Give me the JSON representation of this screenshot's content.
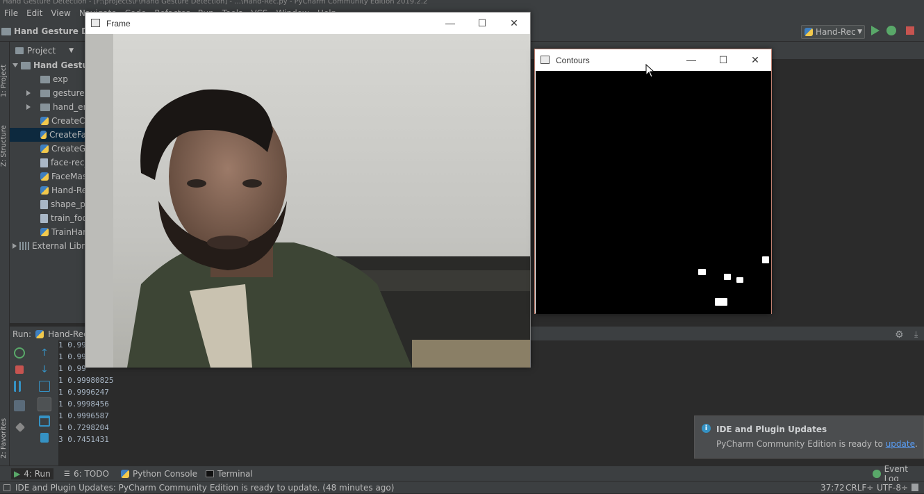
{
  "titlebar": {
    "text": "Hand Gesture Detection - [F:\\projects\\F\\Hand Gesture Detection] - ...\\Hand-Rec.py - PyCharm Community Edition 2019.2.2"
  },
  "menu": [
    "File",
    "Edit",
    "View",
    "Navigate",
    "Code",
    "Refactor",
    "Run",
    "Tools",
    "VCS",
    "Window",
    "Help"
  ],
  "navbar": {
    "project_crumb": "Hand Gesture Det",
    "run_config": "Hand-Rec"
  },
  "project_pane": {
    "header": "Project",
    "root": "Hand Gesture",
    "items": [
      {
        "label": "exp",
        "kind": "folder",
        "expandable": false
      },
      {
        "label": "gestures",
        "kind": "folder",
        "expandable": true
      },
      {
        "label": "hand_em",
        "kind": "folder",
        "expandable": true
      },
      {
        "label": "CreateCS",
        "kind": "python"
      },
      {
        "label": "CreateFa",
        "kind": "python",
        "selected": true
      },
      {
        "label": "CreateGe",
        "kind": "python"
      },
      {
        "label": "face-rec_",
        "kind": "file"
      },
      {
        "label": "FaceMas",
        "kind": "python"
      },
      {
        "label": "Hand-Re",
        "kind": "python"
      },
      {
        "label": "shape_pr",
        "kind": "file"
      },
      {
        "label": "train_foo",
        "kind": "file"
      },
      {
        "label": "TrainHar",
        "kind": "python"
      }
    ],
    "external": "External Libra"
  },
  "left_tabs": {
    "project": "1: Project",
    "structure": "Z: Structure",
    "favorites": "2: Favorites"
  },
  "run_panel": {
    "label": "Run:",
    "config": "Hand-Rec",
    "console_lines": [
      "1 0.99",
      "1 0.99",
      "1 0.99",
      "1 0.99980825",
      "1 0.9996247",
      "1 0.9998456",
      "1 0.9996587",
      "1 0.7298204",
      "3 0.7451431"
    ]
  },
  "frame_window": {
    "title": "Frame",
    "minimize": "—",
    "maximize": "☐",
    "close": "✕"
  },
  "contours_window": {
    "title": "Contours",
    "minimize": "—",
    "maximize": "☐",
    "close": "✕"
  },
  "notification": {
    "title": "IDE and Plugin Updates",
    "body": "PyCharm Community Edition is ready to ",
    "link": "update",
    "suffix": "."
  },
  "tool_tabs": {
    "run": "4: Run",
    "todo": "6: TODO",
    "python_console": "Python Console",
    "terminal": "Terminal",
    "event_log": "Event Log"
  },
  "statusbar": {
    "message": "IDE and Plugin Updates: PyCharm Community Edition is ready to update. (48 minutes ago)",
    "position": "37:72",
    "line_sep": "CRLF÷",
    "encoding": "UTF-8÷"
  },
  "colors": {
    "accent": "#3592c4",
    "run_green": "#59a869",
    "stop_red": "#c75450",
    "link": "#589df6"
  }
}
